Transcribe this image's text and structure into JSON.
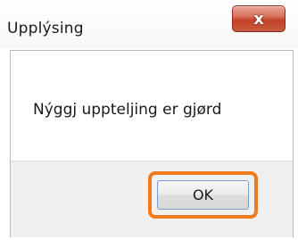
{
  "dialog": {
    "title": "Upplýsing",
    "close_label": "x",
    "message": "Nýggj uppteljing er gjørd",
    "ok_label": "OK"
  },
  "colors": {
    "close_button": "#c4432a",
    "highlight": "#f07b1e",
    "button_border": "#7a9ccf"
  }
}
